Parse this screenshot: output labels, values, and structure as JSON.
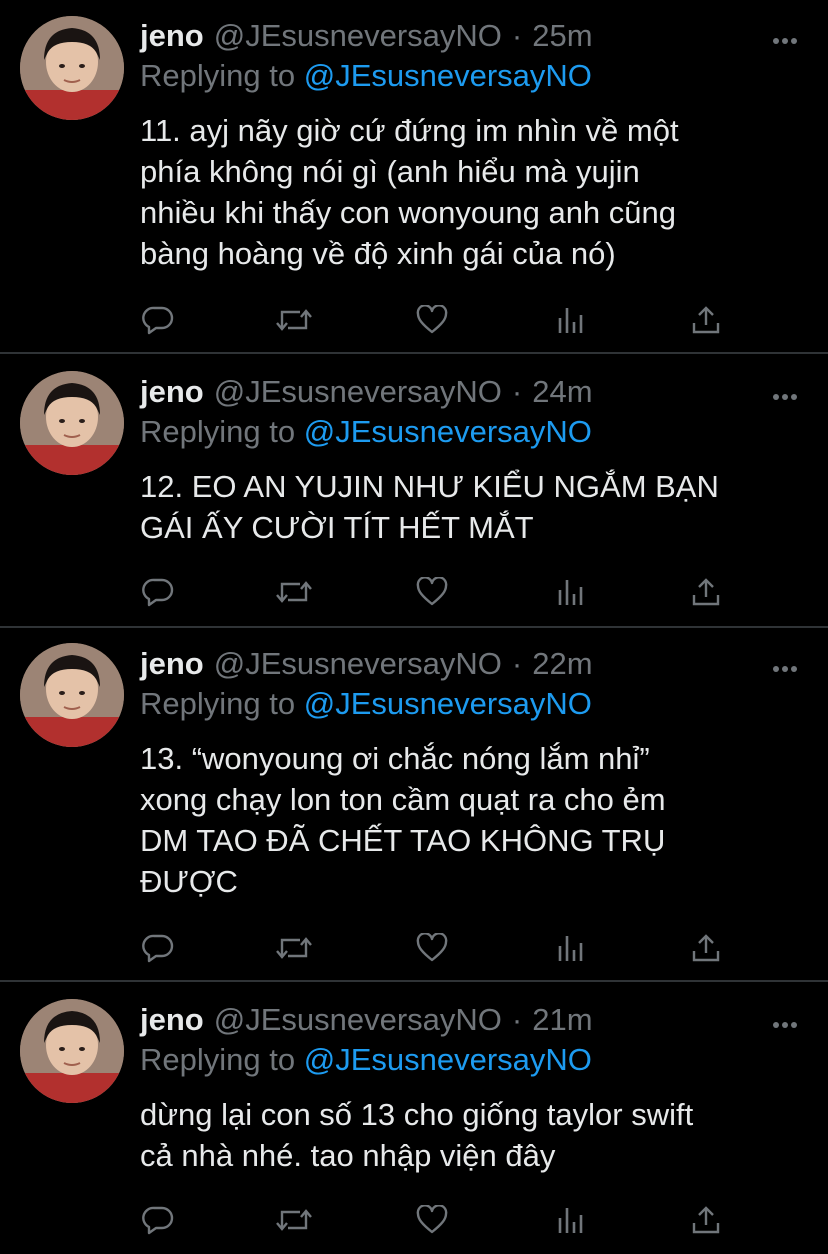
{
  "tweets": [
    {
      "name": "jeno",
      "handle": "@JEsusneversayNO",
      "separator": "·",
      "time": "25m",
      "replying_prefix": "Replying to",
      "replying_to": "@JEsusneversayNO",
      "text_lines": [
        "11. ayj nãy giờ cứ đứng im nhìn về một",
        "phía không nói gì (anh hiểu mà yujin",
        "nhiều khi thấy con wonyoung anh cũng",
        "bàng hoàng về độ xinh gái của nó)"
      ]
    },
    {
      "name": "jeno",
      "handle": "@JEsusneversayNO",
      "separator": "·",
      "time": "24m",
      "replying_prefix": "Replying to",
      "replying_to": "@JEsusneversayNO",
      "text_lines": [
        "12. EO AN YUJIN NHƯ KIỂU NGẮM BẠN",
        "GÁI ẤY CƯỜI TÍT HẾT MẮT"
      ]
    },
    {
      "name": "jeno",
      "handle": "@JEsusneversayNO",
      "separator": "·",
      "time": "22m",
      "replying_prefix": "Replying to",
      "replying_to": "@JEsusneversayNO",
      "text_lines": [
        "13. “wonyoung ơi chắc nóng lắm nhỉ”",
        "xong chạy lon ton cầm quạt ra cho ẻm",
        "DM TAO ĐÃ CHẾT TAO KHÔNG TRỤ",
        "ĐƯỢC"
      ]
    },
    {
      "name": "jeno",
      "handle": "@JEsusneversayNO",
      "separator": "·",
      "time": "21m",
      "replying_prefix": "Replying to",
      "replying_to": "@JEsusneversayNO",
      "text_lines": [
        "dừng lại con số 13 cho giống taylor swift",
        "cả nhà nhé. tao nhập viện đây"
      ]
    }
  ],
  "icons": {
    "more": "more-horizontal-icon",
    "reply": "reply-icon",
    "retweet": "retweet-icon",
    "like": "heart-icon",
    "analytics": "analytics-icon",
    "share": "share-icon"
  },
  "colors": {
    "background": "#000000",
    "text_primary": "#e7e9ea",
    "text_secondary": "#71767b",
    "accent": "#1d9bf0",
    "divider": "#2f3336"
  }
}
